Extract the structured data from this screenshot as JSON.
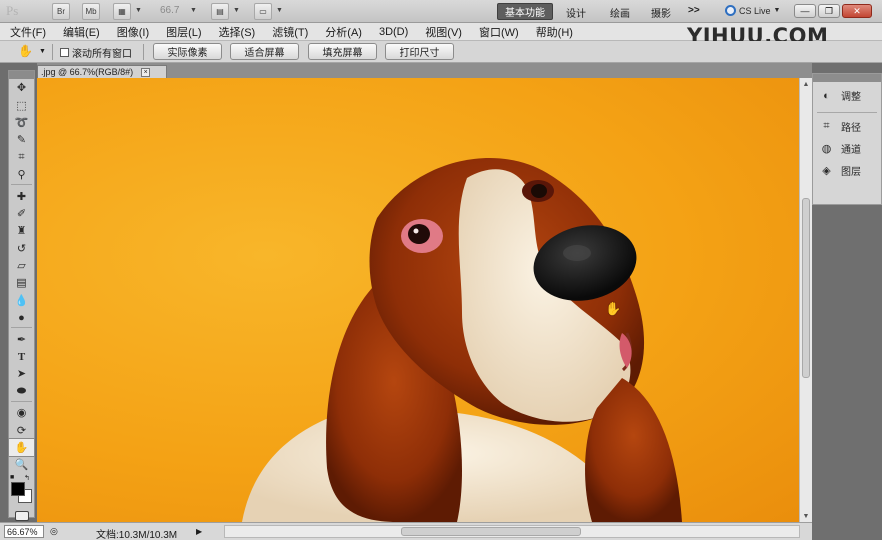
{
  "app": {
    "logo": "Ps",
    "zoom_value": "66.7",
    "app_buttons": [
      "Br",
      "Mb"
    ],
    "workspaces": {
      "active": "基本功能",
      "others": [
        "设计",
        "绘画",
        "摄影"
      ],
      "more": ">>"
    },
    "cs_live": "CS Live"
  },
  "menu": {
    "items": [
      "文件(F)",
      "编辑(E)",
      "图像(I)",
      "图层(L)",
      "选择(S)",
      "滤镜(T)",
      "分析(A)",
      "3D(D)",
      "视图(V)",
      "窗口(W)",
      "帮助(H)"
    ]
  },
  "watermark": "YIHUU.COM",
  "options": {
    "scroll_all_windows": "滚动所有窗口",
    "buttons": [
      "实际像素",
      "适合屏幕",
      "填充屏幕",
      "打印尺寸"
    ]
  },
  "document": {
    "tab_label": ".jpg @ 66.7%(RGB/8#)",
    "close": "×"
  },
  "status": {
    "zoom": "66.67%",
    "doc_size": "文档:10.3M/10.3M"
  },
  "panels": {
    "adjust": "调整",
    "paths": "路径",
    "channels": "通道",
    "layers": "图层"
  },
  "colors": {
    "foreground": "#000000",
    "background": "#ffffff",
    "canvas_bg": "#f4a215"
  }
}
